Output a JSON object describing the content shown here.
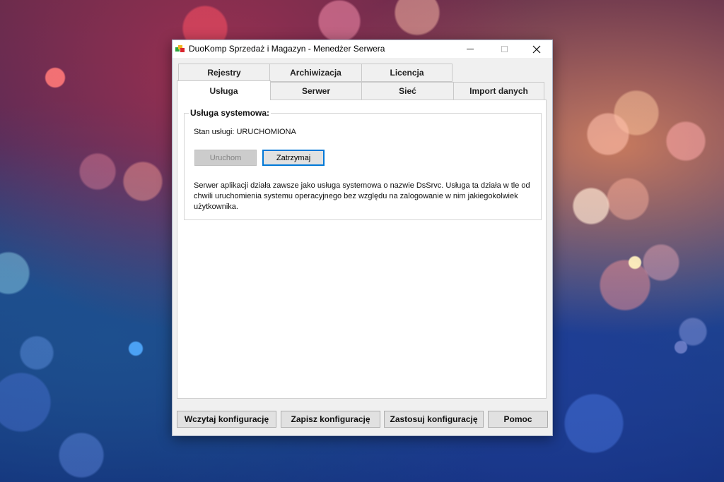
{
  "window": {
    "title": "DuoKomp Sprzedaż i Magazyn - Menedżer Serwera",
    "icon": "app-cubes-icon",
    "controls": {
      "minimize": "minimize-icon",
      "maximize": "maximize-icon",
      "close": "close-icon"
    }
  },
  "tabs": {
    "row1": [
      {
        "label": "Rejestry"
      },
      {
        "label": "Archiwizacja"
      },
      {
        "label": "Licencja"
      }
    ],
    "row2": [
      {
        "label": "Usługa",
        "active": true
      },
      {
        "label": "Serwer"
      },
      {
        "label": "Sieć"
      },
      {
        "label": "Import danych"
      }
    ]
  },
  "service": {
    "group_title": "Usługa systemowa:",
    "status_label": "Stan usługi:",
    "status_value": "URUCHOMIONA",
    "start_label": "Uruchom",
    "stop_label": "Zatrzymaj",
    "description": "Serwer aplikacji działa zawsze jako usługa systemowa o nazwie DsSrvc. Usługa ta działa w tle od chwili uruchomienia systemu operacyjnego bez względu na zalogowanie w nim jakiegokolwiek użytkownika."
  },
  "footer": {
    "load_label": "Wczytaj konfigurację",
    "save_label": "Zapisz konfigurację",
    "apply_label": "Zastosuj konfigurację",
    "help_label": "Pomoc"
  },
  "colors": {
    "focus_border": "#0078d7",
    "window_bg": "#f0f0f0",
    "panel_bg": "#ffffff"
  }
}
